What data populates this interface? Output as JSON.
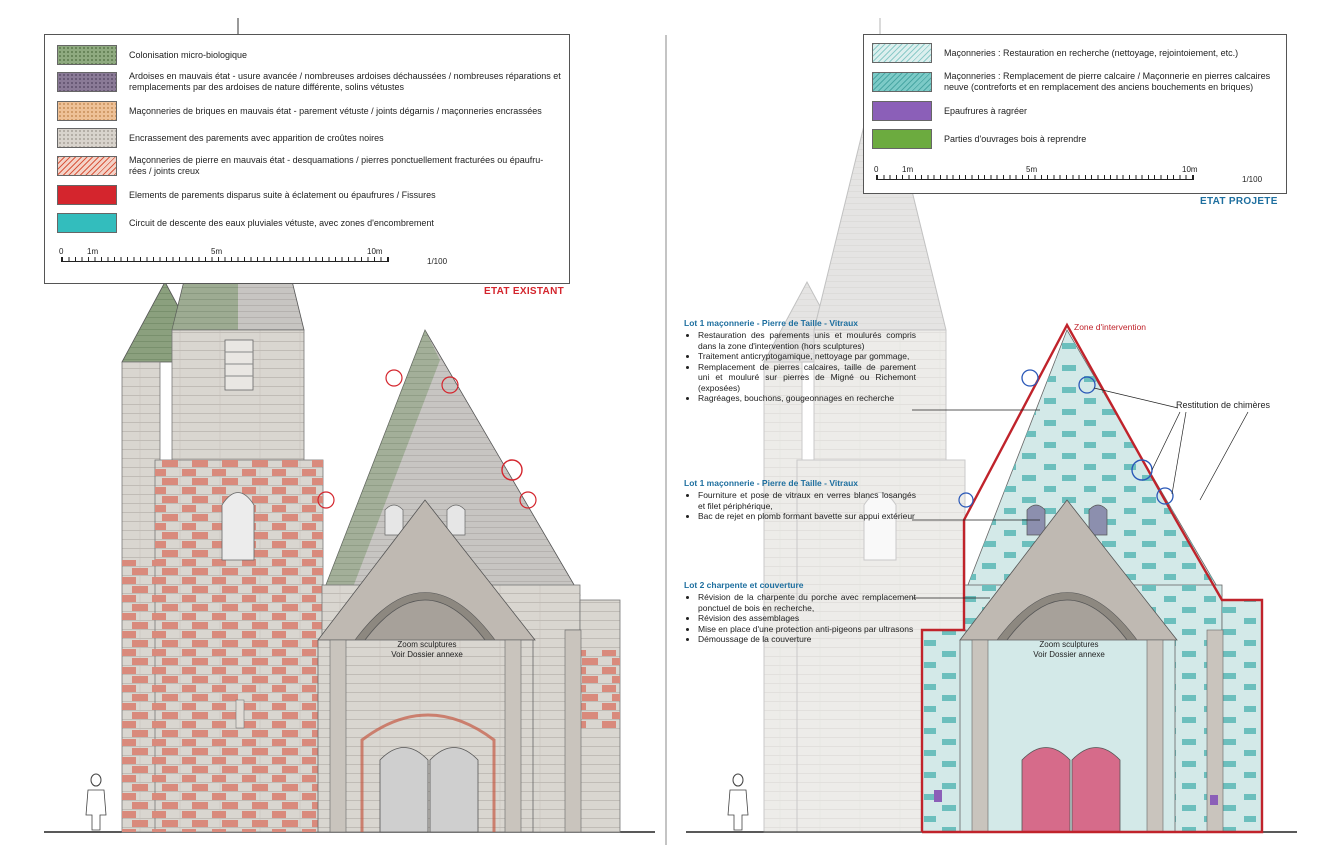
{
  "left_panel": {
    "legend": [
      {
        "label": "Colonisation micro-biologique",
        "color": "#7a9a6a"
      },
      {
        "label": "Ardoises en mauvais état - usure avancée / nombreuses ardoises déchaussées / nombreuses réparations et remplacements par des ardoises de nature différente, solins vétustes",
        "color": "#8a7a96"
      },
      {
        "label": "Maçonneries de briques en mauvais état - parement vétuste / joints dégarnis / maçonneries encrassées",
        "color": "#e8b07a"
      },
      {
        "label": "Encrassement des parements avec apparition de croûtes noires",
        "color": "#c9c3bb"
      },
      {
        "label": "Maçonneries de pierre en mauvais état - desquamations / pierres ponctuellement fracturées ou épaufru-rées / joints creux",
        "color": "#e89a86"
      },
      {
        "label": "Elements de parements disparus suite à éclatement ou épaufrures / Fissures",
        "color": "#d4252d"
      },
      {
        "label": "Circuit de descente des eaux pluviales vétuste, avec zones d'encombrement",
        "color": "#33bdbd"
      }
    ],
    "scale": {
      "ticks": [
        "0",
        "1m",
        "5m",
        "10m"
      ],
      "ratio": "1/100"
    },
    "title": "ETAT EXISTANT",
    "zoom_label": [
      "Zoom sculptures",
      "Voir Dossier annexe"
    ]
  },
  "right_panel": {
    "legend": [
      {
        "label": "Maçonneries : Restauration en recherche (nettoyage, rejointoiement, etc.)",
        "color": "#cfe7e6"
      },
      {
        "label": "Maçonneries : Remplacement de pierre calcaire / Maçonnerie en pierres calcaires neuve (contreforts et en remplacement des anciens bouchements en briques)",
        "color": "#6cbfbd"
      },
      {
        "label": "Epaufrures à ragréer",
        "color": "#8b5fb8"
      },
      {
        "label": "Parties d'ouvrages bois à reprendre",
        "color": "#6cab3f"
      }
    ],
    "scale": {
      "ticks": [
        "0",
        "1m",
        "5m",
        "10m"
      ],
      "ratio": "1/100"
    },
    "title": "ETAT PROJETE",
    "zone_label": "Zone d'intervention",
    "chimeres_label": "Restitution de chimères",
    "zoom_label": [
      "Zoom sculptures",
      "Voir Dossier annexe"
    ],
    "lots": [
      {
        "title": "Lot 1 maçonnerie - Pierre de Taille - Vitraux",
        "items": [
          "Restauration des parements unis et moulurés compris dans la zone d'intervention (hors sculptures)",
          "Traitement anticryptogamique, nettoyage par gommage,",
          "Remplacement de pierres calcaires, taille de parement uni et mouluré sur pierres de Migné ou Richemont (exposées)",
          "Ragréages, bouchons, gougeonnages en recherche"
        ]
      },
      {
        "title": "Lot 1 maçonnerie - Pierre de Taille - Vitraux",
        "items": [
          "Fourniture et pose de vitraux en verres blancs losangés et filet périphérique,",
          "Bac de rejet en plomb formant bavette sur appui extérieur"
        ]
      },
      {
        "title": "Lot 2 charpente et couverture",
        "items": [
          "Révision de la charpente du porche avec remplacement ponctuel de bois en recherche,",
          "Révision des assemblages",
          "Mise en place d'une protection anti-pigeons par ultrasons",
          "Démoussage de la couverture"
        ]
      }
    ]
  }
}
